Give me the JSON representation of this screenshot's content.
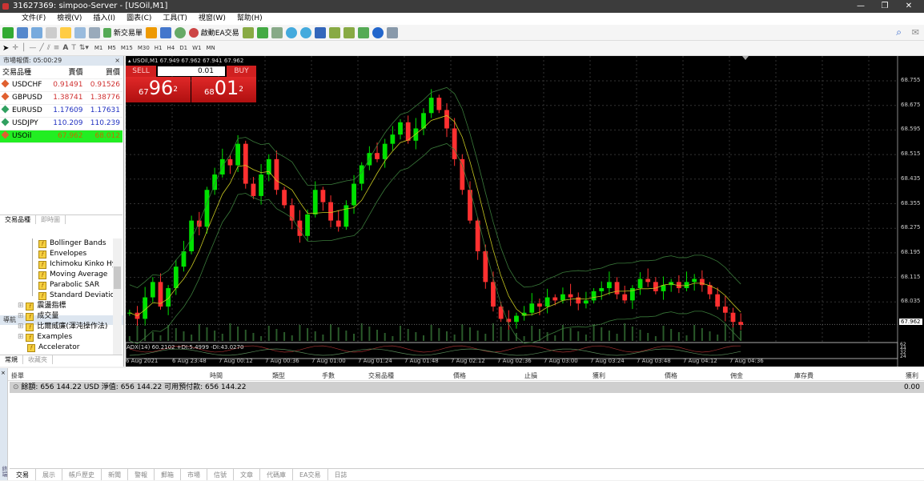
{
  "window": {
    "title": "31627369: simpoo-Server - [USOil,M1]",
    "controls": [
      "—",
      "❐",
      "✕"
    ]
  },
  "menu": [
    "文件(F)",
    "檢視(V)",
    "插入(I)",
    "圖表(C)",
    "工具(T)",
    "視窗(W)",
    "幫助(H)"
  ],
  "toolbar": {
    "new_order": "新交易單",
    "autotrading": "啟動EA交易",
    "timeframes": [
      "M1",
      "M5",
      "M15",
      "M30",
      "H1",
      "H4",
      "D1",
      "W1",
      "MN"
    ],
    "text_tool": "A"
  },
  "market_watch": {
    "title": "市場報價: 05:00:29",
    "headers": [
      "交易品種",
      "賣價",
      "買價"
    ],
    "rows": [
      {
        "symbol": "USDCHF",
        "bid": "0.91491",
        "ask": "0.91526",
        "dir": "down"
      },
      {
        "symbol": "GBPUSD",
        "bid": "1.38741",
        "ask": "1.38776",
        "dir": "down"
      },
      {
        "symbol": "EURUSD",
        "bid": "1.17609",
        "ask": "1.17631",
        "dir": "up"
      },
      {
        "symbol": "USDJPY",
        "bid": "110.209",
        "ask": "110.239",
        "dir": "up"
      },
      {
        "symbol": "USOil",
        "bid": "67.962",
        "ask": "68.012",
        "dir": "selected"
      }
    ],
    "tabs": [
      "交易品種",
      "即時圖"
    ]
  },
  "navigator": {
    "title": "導航",
    "items": [
      "Bollinger Bands",
      "Envelopes",
      "Ichimoku Kinko Hy",
      "Moving Average",
      "Parabolic SAR",
      "Standard Deviatio"
    ],
    "groups": [
      "震盪指標",
      "成交量",
      "比爾威廉(渾沌操作法)",
      "Examples",
      "Accelerator"
    ],
    "tabs": [
      "常規",
      "收藏夾"
    ]
  },
  "chart": {
    "header": "USOil,M1  67.949 67.962 67.941 67.962",
    "one_click": {
      "sell": "SELL",
      "buy": "BUY",
      "lot": "0.01",
      "sell_big": "96",
      "sell_small": "67",
      "sell_sup": "2",
      "buy_big": "01",
      "buy_small": "68",
      "buy_sup": "2"
    },
    "price_labels": [
      "68.755",
      "68.675",
      "68.595",
      "68.515",
      "68.435",
      "68.355",
      "68.275",
      "68.195",
      "68.115",
      "68.035"
    ],
    "current_price": "67.962",
    "indicator_label": "ADX(14) 60.2102 +DI:5.4999 -DI:43.0270",
    "indicator_scale": [
      "62",
      "44",
      "32",
      "24"
    ],
    "time_labels": [
      "6 Aug 2021",
      "6 Aug 23:48",
      "7 Aug 00:12",
      "7 Aug 00:36",
      "7 Aug 01:00",
      "7 Aug 01:24",
      "7 Aug 01:48",
      "7 Aug 02:12",
      "7 Aug 02:36",
      "7 Aug 03:00",
      "7 Aug 03:24",
      "7 Aug 03:48",
      "7 Aug 04:12",
      "7 Aug 04:36"
    ],
    "closes": [
      68.0,
      67.98,
      68.05,
      68.1,
      68.02,
      68.08,
      68.15,
      68.2,
      68.3,
      68.28,
      68.4,
      68.45,
      68.5,
      68.48,
      68.55,
      68.42,
      68.38,
      68.45,
      68.5,
      68.4,
      68.35,
      68.3,
      68.25,
      68.32,
      68.4,
      68.36,
      68.3,
      68.28,
      68.35,
      68.42,
      68.48,
      68.52,
      68.5,
      68.55,
      68.58,
      68.62,
      68.56,
      68.6,
      68.65,
      68.7,
      68.66,
      68.6,
      68.5,
      68.4,
      68.3,
      68.2,
      68.1,
      68.02,
      67.98,
      67.97,
      67.99,
      68.0,
      68.03,
      68.02,
      68.05,
      68.04,
      68.06,
      68.05,
      68.03,
      68.04,
      68.07,
      68.08,
      68.1,
      68.06,
      68.04,
      68.08,
      68.11,
      68.1,
      68.07,
      68.09,
      68.1,
      68.08,
      68.1,
      68.11,
      68.09,
      68.06,
      68.02,
      68.0,
      67.97,
      67.96
    ],
    "colors": {
      "bull": "#00e000",
      "bear": "#ff3030",
      "bg": "#000000",
      "grid": "#333333"
    }
  },
  "terminal": {
    "side_label": "終端",
    "headers": [
      "掛單",
      "時間",
      "類型",
      "手數",
      "交易品種",
      "價格",
      "止損",
      "獲利",
      "價格",
      "佣金",
      "庫存費",
      "獲利"
    ],
    "balance": "餘額: 656 144.22 USD  淨值: 656 144.22  可用預付款: 656 144.22",
    "balance_profit": "0.00",
    "tabs": [
      "交易",
      "展示",
      "帳戶歷史",
      "新聞",
      "警報",
      "郵箱",
      "市場",
      "信號",
      "文章",
      "代碼庫",
      "EA交易",
      "日誌"
    ]
  }
}
